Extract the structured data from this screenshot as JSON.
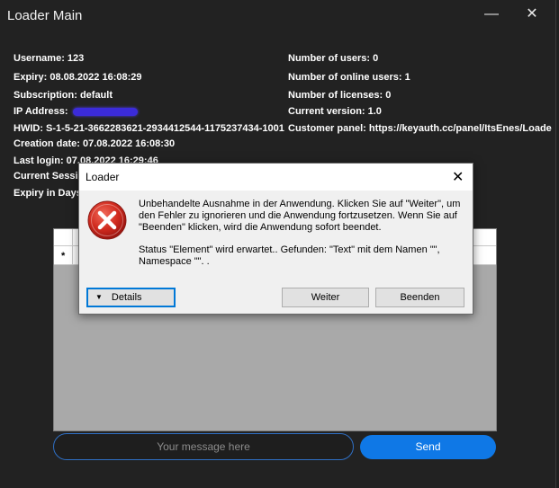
{
  "main_window": {
    "title": "Loader Main",
    "minimize_glyph": "—",
    "close_glyph": "✕"
  },
  "info_left": {
    "username": "Username: 123",
    "expiry": "Expiry: 08.08.2022 16:08:29",
    "subscription": "Subscription: default",
    "ip_address": "IP Address: ",
    "hwid": "HWID: S-1-5-21-3662283621-2934412544-1175237434-1001",
    "creation_date": "Creation date: 07.08.2022 16:08:30",
    "last_login": "Last login: 07.08.2022 16:29:46",
    "current_session": "Current Sessio",
    "expiry_in_days": "Expiry in Days"
  },
  "info_right": {
    "num_users": "Number of users: 0",
    "num_online_users": "Number of online users: 1",
    "num_licenses": "Number of licenses: 0",
    "current_version": "Current version: 1.0",
    "customer_panel": "Customer panel: https://keyauth.cc/panel/ItsEnes/Loade"
  },
  "grid": {
    "new_row_marker": "*"
  },
  "chat": {
    "input_placeholder": "Your message here",
    "send_label": "Send"
  },
  "dialog": {
    "title": "Loader",
    "close_glyph": "✕",
    "message_line1": "Unbehandelte Ausnahme in der Anwendung. Klicken Sie auf \"Weiter\", um den Fehler zu ignorieren und die Anwendung fortzusetzen. Wenn Sie auf \"Beenden\" klicken, wird die Anwendung sofort beendet.",
    "message_line2": "Status \"Element\" wird erwartet.. Gefunden: \"Text\" mit dem Namen \"\", Namespace \"\". .",
    "details_label": "Details",
    "details_arrow": "▼",
    "continue_label": "Weiter",
    "quit_label": "Beenden"
  },
  "colors": {
    "window_bg": "#222222",
    "accent_blue": "#0f78e6",
    "error_red": "#c42b1c",
    "redaction": "#3b2bd9"
  }
}
